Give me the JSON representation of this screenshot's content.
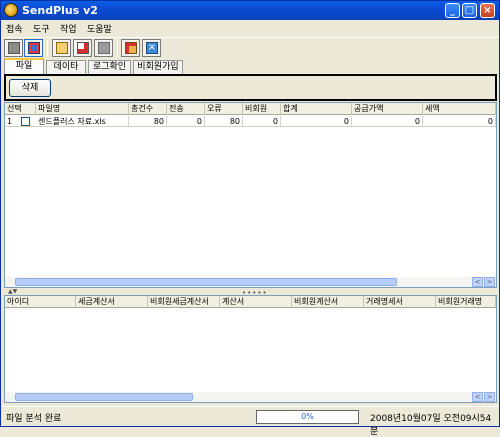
{
  "window": {
    "title": "SendPlus v2"
  },
  "menu": [
    "접속",
    "도구",
    "작업",
    "도움말"
  ],
  "tabs": [
    "파일",
    "데이타",
    "로그확인",
    "비회원가입"
  ],
  "panel": {
    "delete_label": "삭제"
  },
  "grid1": {
    "columns": [
      "선택",
      "파일명",
      "총건수",
      "전송",
      "오류",
      "비회원",
      "합계",
      "공급가액",
      "세액"
    ],
    "rows": [
      {
        "index": "1",
        "filename": "센드플러스 자료.xls",
        "total": "80",
        "sent": "0",
        "error": "80",
        "nonmember": "0",
        "sum": "0",
        "supply": "0",
        "tax": "0"
      }
    ]
  },
  "grid2": {
    "columns": [
      "아이디",
      "세금계산서",
      "비회원세금계산서",
      "계산서",
      "비회원계산서",
      "거래명세서",
      "비회원거래명"
    ]
  },
  "status": {
    "message": "파일 분석 완료",
    "progress_text": "0%",
    "progress_value": 0,
    "datetime": "2008년10월07일 오전09시54분"
  },
  "colors": {
    "titlebar": "#0a5fe6",
    "tab_highlight": "#ffc83c",
    "grid_border": "#7f9db9"
  }
}
